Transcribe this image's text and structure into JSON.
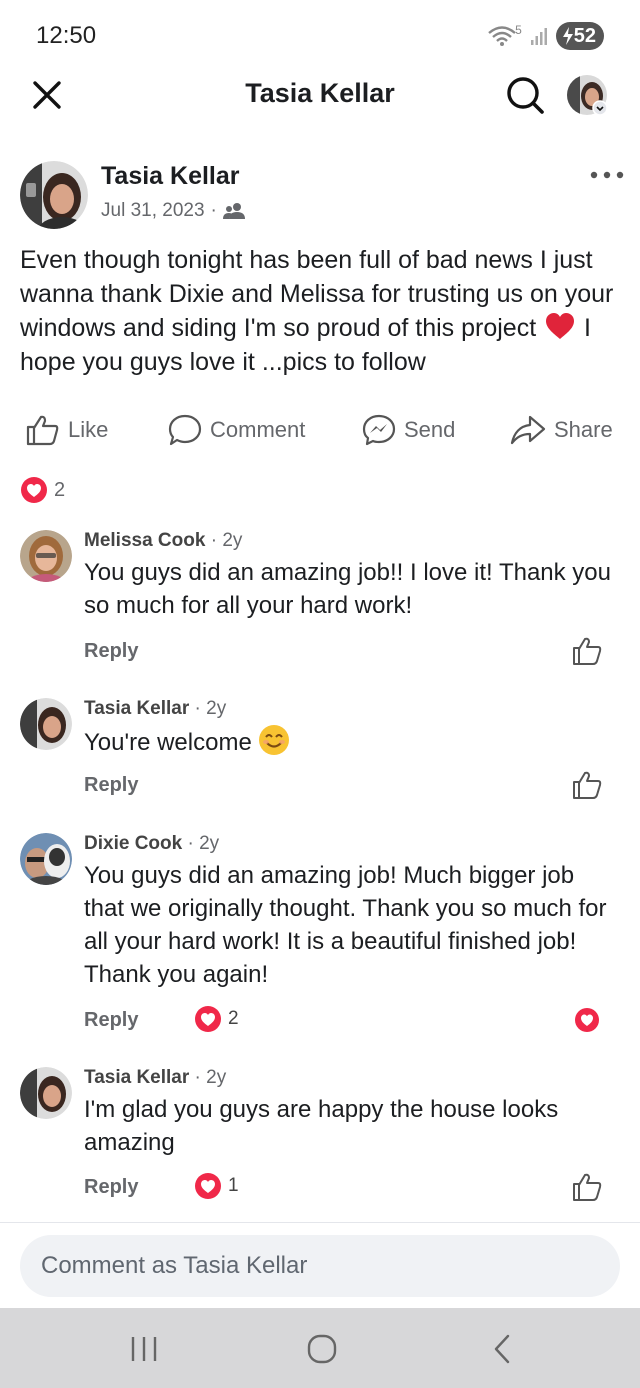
{
  "status_bar": {
    "time": "12:50",
    "battery": "52",
    "network": "5"
  },
  "header": {
    "title": "Tasia Kellar"
  },
  "post": {
    "author": "Tasia Kellar",
    "date": "Jul 31, 2023",
    "text_before_emoji": "Even though tonight has been full of bad news I just wanna thank Dixie and Melissa for trusting us on your windows and siding I'm so proud of this project",
    "text_after_emoji": " I hope you guys love it ...pics to follow",
    "reaction_count": "2"
  },
  "actions": {
    "like": "Like",
    "comment": "Comment",
    "send": "Send",
    "share": "Share"
  },
  "comments": [
    {
      "author": "Melissa Cook",
      "time": "2y",
      "text": "You guys did an amazing job!! I love it! Thank you so much for all your hard work!",
      "reply": "Reply"
    },
    {
      "author": "Tasia Kellar",
      "time": "2y",
      "text": "You're welcome",
      "emoji": "😊",
      "reply": "Reply"
    },
    {
      "author": "Dixie Cook",
      "time": "2y",
      "text": "You guys did an amazing job! Much bigger job that we originally thought.  Thank you so much for all your hard work! It is a beautiful finished job! Thank you again!",
      "reply": "Reply",
      "reaction_count": "2"
    },
    {
      "author": "Tasia Kellar",
      "time": "2y",
      "text": "I'm glad you guys are happy the house looks amazing",
      "reply": "Reply",
      "reaction_count": "1"
    }
  ],
  "composer": {
    "placeholder": "Comment as Tasia Kellar"
  },
  "colors": {
    "love_red": "#f02849",
    "heart_red": "#e0243a",
    "icon_gray": "#65676b",
    "composer_bg": "#f0f2f5",
    "navbar_bg": "#d7d7d9"
  }
}
